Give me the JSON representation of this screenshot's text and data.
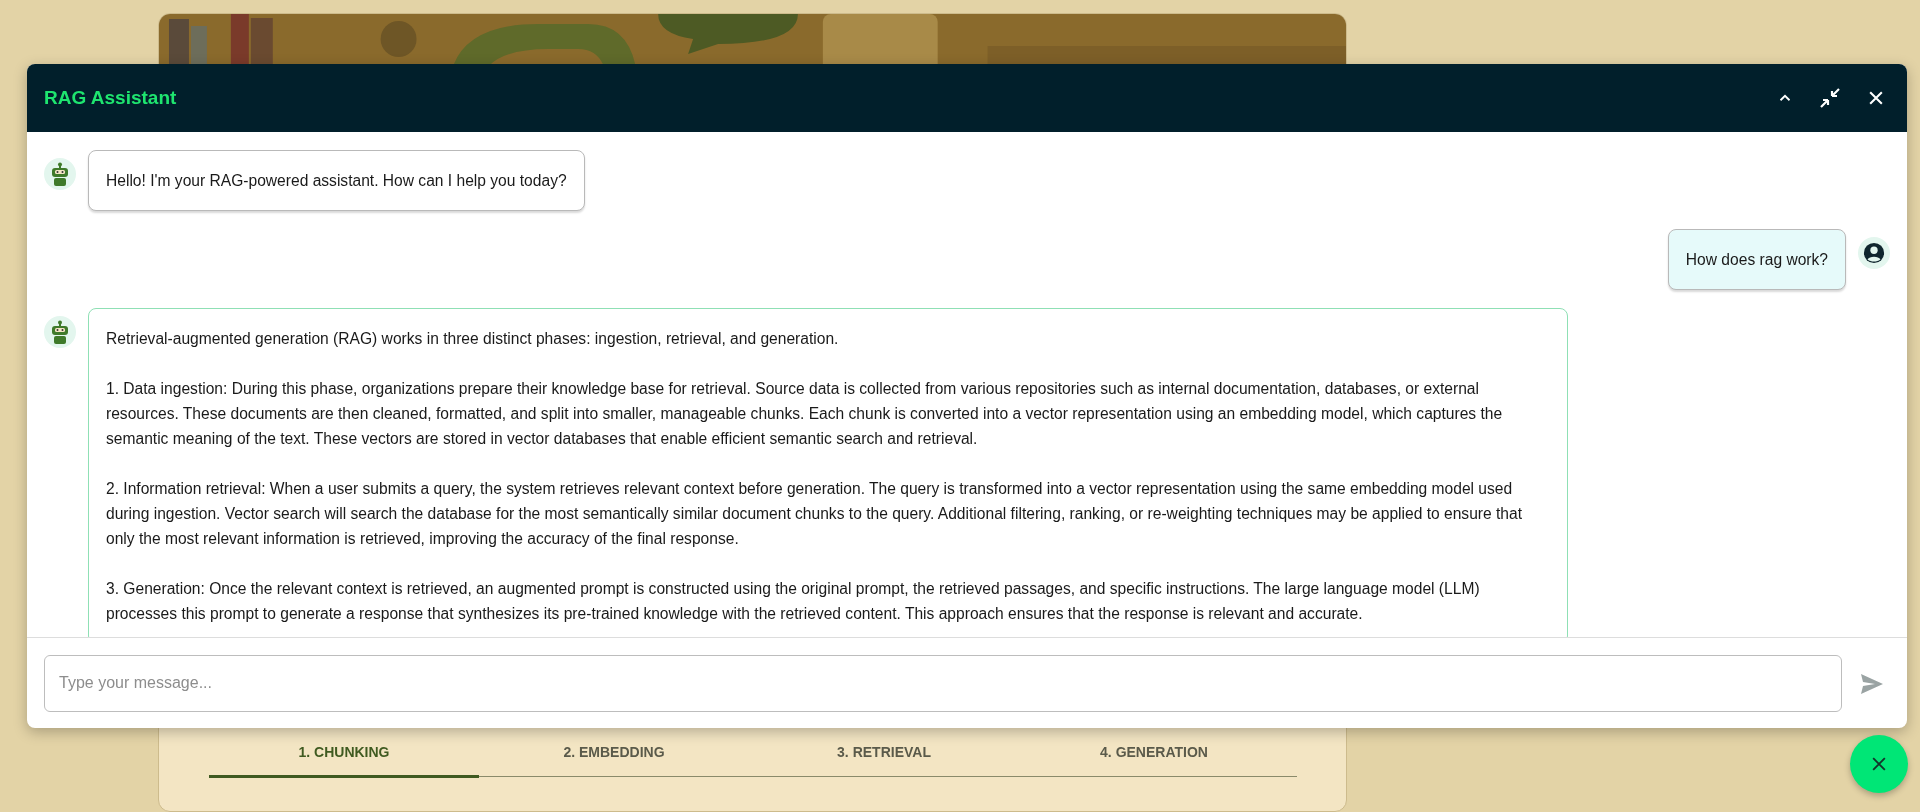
{
  "background_page": {
    "tabs": [
      {
        "label": "1. CHUNKING",
        "selected": true
      },
      {
        "label": "2. EMBEDDING",
        "selected": false
      },
      {
        "label": "3. RETRIEVAL",
        "selected": false
      },
      {
        "label": "4. GENERATION",
        "selected": false
      }
    ]
  },
  "chat": {
    "title": "RAG Assistant",
    "messages": [
      {
        "kind": "assistant",
        "highlighted": false,
        "paragraphs": [
          "Hello! I'm your RAG-powered assistant. How can I help you today?"
        ]
      },
      {
        "kind": "user",
        "highlighted": false,
        "paragraphs": [
          "How does rag work?"
        ]
      },
      {
        "kind": "assistant",
        "highlighted": true,
        "paragraphs": [
          "Retrieval-augmented generation (RAG) works in three distinct phases: ingestion, retrieval, and generation.",
          "1. Data ingestion: During this phase, organizations prepare their knowledge base for retrieval. Source data is collected from various repositories such as internal documentation, databases, or external resources. These documents are then cleaned, formatted, and split into smaller, manageable chunks. Each chunk is converted into a vector representation using an embedding model, which captures the semantic meaning of the text. These vectors are stored in vector databases that enable efficient semantic search and retrieval.",
          "2. Information retrieval: When a user submits a query, the system retrieves relevant context before generation. The query is transformed into a vector representation using the same embedding model used during ingestion. Vector search will search the database for the most semantically similar document chunks to the query. Additional filtering, ranking, or re-weighting techniques may be applied to ensure that only the most relevant information is retrieved, improving the accuracy of the final response.",
          "3. Generation: Once the relevant context is retrieved, an augmented prompt is constructed using the original prompt, the retrieved passages, and specific instructions. The large language model (LLM) processes this prompt to generate a response that synthesizes its pre-trained knowledge with the retrieved content. This approach ensures that the response is relevant and accurate."
        ]
      }
    ],
    "input": {
      "placeholder": "Type your message..."
    }
  }
}
